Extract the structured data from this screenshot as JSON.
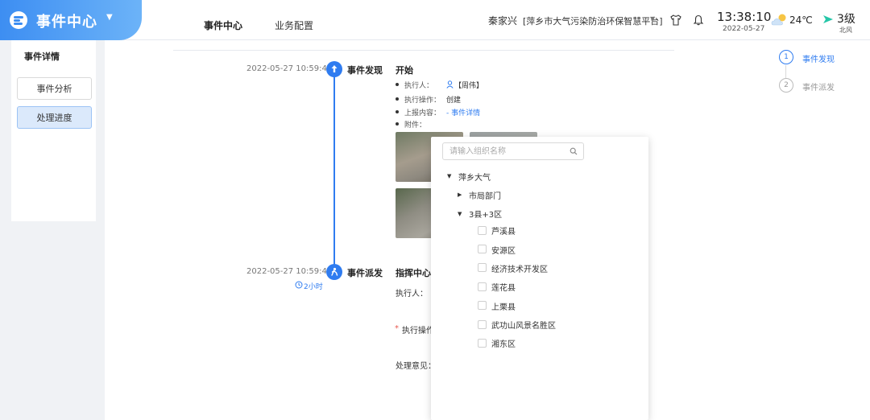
{
  "header": {
    "app_title": "事件中心",
    "nav": [
      "事件中心",
      "业务配置"
    ],
    "user_name": "秦家兴",
    "platform": "[萍乡市大气污染防治环保智慧平台]",
    "time": "13:38:10",
    "date": "2022-05-27",
    "temperature": "24℃",
    "wind_level": "3级",
    "wind_direction": "北风"
  },
  "left_panel": {
    "title": "事件详情",
    "buttons": [
      "事件分析",
      "处理进度"
    ],
    "active_index": 1
  },
  "timeline": [
    {
      "time": "2022-05-27 10:59:41",
      "label": "事件发现",
      "heading": "开始",
      "rows": [
        {
          "label": "执行人：",
          "value": "【周伟】"
        },
        {
          "label": "执行操作：",
          "value": "创建"
        },
        {
          "label": "上报内容：",
          "value": "- 事件详情"
        },
        {
          "label": "附件：",
          "value": ""
        }
      ]
    },
    {
      "time": "2022-05-27 10:59:41",
      "label": "事件派发",
      "duration": "2小时",
      "heading": "指挥中心派",
      "fields": [
        "执行人：",
        "执行操作",
        "处理意见："
      ]
    }
  ],
  "steps": [
    {
      "num": "1",
      "label": "事件发现",
      "active": true
    },
    {
      "num": "2",
      "label": "事件派发",
      "active": false
    }
  ],
  "dropdown": {
    "placeholder": "请输入组织名称",
    "root": "萍乡大气",
    "group_collapsed": "市局部门",
    "group_expanded": "3县+3区",
    "items": [
      "芦溪县",
      "安源区",
      "经济技术开发区",
      "莲花县",
      "上栗县",
      "武功山风景名胜区",
      "湘东区"
    ]
  },
  "colors": {
    "primary": "#2f7cf0",
    "brand_gradient_start": "#3d8ef2",
    "brand_gradient_end": "#6cb3f8",
    "active_tab_bg": "#dbe9fb",
    "required_star": "#e8584f"
  }
}
